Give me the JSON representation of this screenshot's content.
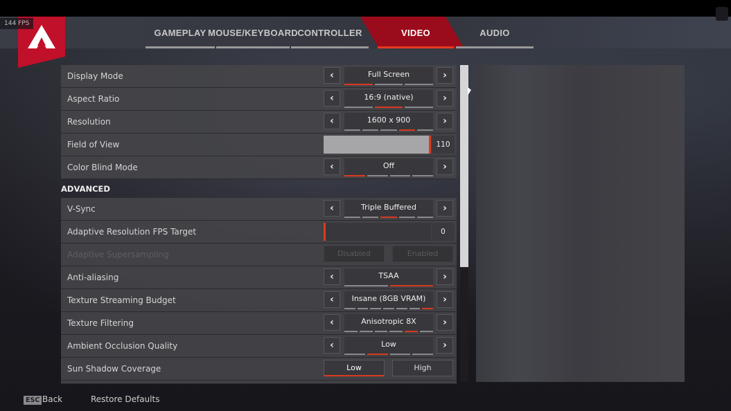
{
  "fps_counter": "144 FPS",
  "tabs": [
    {
      "label": "GAMEPLAY",
      "active": false
    },
    {
      "label": "MOUSE/KEYBOARD",
      "active": false
    },
    {
      "label": "CONTROLLER",
      "active": false
    },
    {
      "label": "VIDEO",
      "active": true
    },
    {
      "label": "AUDIO",
      "active": false
    }
  ],
  "settings": {
    "display_mode": {
      "label": "Display Mode",
      "value": "Full Screen",
      "option_count": 3,
      "selected_index": 0
    },
    "aspect_ratio": {
      "label": "Aspect Ratio",
      "value": "16:9 (native)",
      "option_count": 3,
      "selected_index": 1
    },
    "resolution": {
      "label": "Resolution",
      "value": "1600 x 900",
      "option_count": 5,
      "selected_index": 3
    },
    "field_of_view": {
      "label": "Field of View",
      "value": "110",
      "min": 70,
      "max": 110
    },
    "color_blind_mode": {
      "label": "Color Blind Mode",
      "value": "Off",
      "option_count": 4,
      "selected_index": 0
    }
  },
  "advanced_heading": "ADVANCED",
  "advanced": {
    "vsync": {
      "label": "V-Sync",
      "value": "Triple Buffered",
      "option_count": 5,
      "selected_index": 2
    },
    "adaptive_res": {
      "label": "Adaptive Resolution FPS Target",
      "value": "0",
      "fraction": 0
    },
    "adaptive_ss": {
      "label": "Adaptive Supersampling",
      "option_a": "Disabled",
      "option_b": "Enabled",
      "disabled": true
    },
    "anti_aliasing": {
      "label": "Anti-aliasing",
      "value": "TSAA",
      "option_count": 2,
      "selected_index": 1
    },
    "texture_budget": {
      "label": "Texture Streaming Budget",
      "value": "Insane (8GB VRAM)",
      "option_count": 7,
      "selected_index": 6
    },
    "texture_filtering": {
      "label": "Texture Filtering",
      "value": "Anisotropic 8X",
      "option_count": 6,
      "selected_index": 4
    },
    "ao_quality": {
      "label": "Ambient Occlusion Quality",
      "value": "Low",
      "option_count": 4,
      "selected_index": 1
    },
    "sun_shadow": {
      "label": "Sun Shadow Coverage",
      "option_a": "Low",
      "option_b": "High",
      "selected": "Low"
    }
  },
  "footer": {
    "esc_key": "ESC",
    "back_label": "Back",
    "restore_label": "Restore Defaults"
  },
  "colors": {
    "accent": "#d93a20",
    "brand": "#c0102a"
  }
}
